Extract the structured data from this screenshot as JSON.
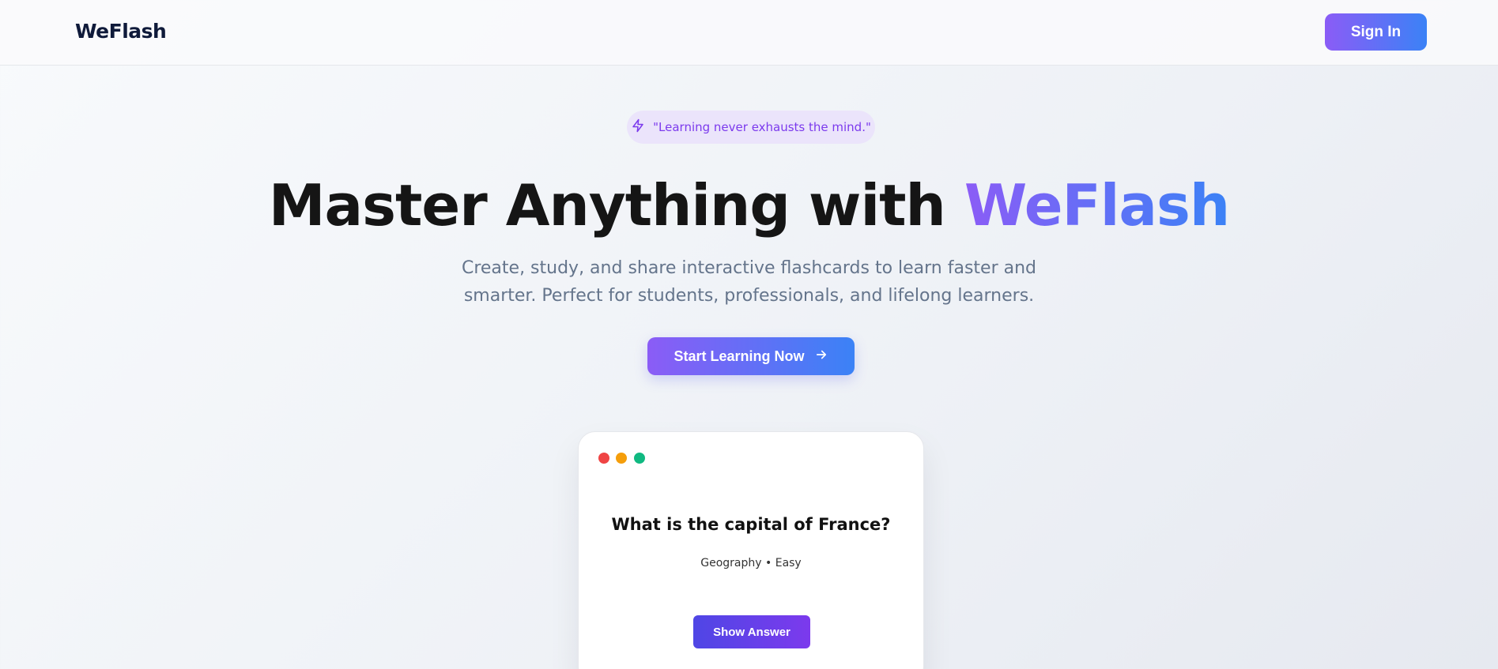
{
  "navbar": {
    "brand": "WeFlash",
    "signin_label": "Sign In"
  },
  "hero": {
    "quote": "\"Learning never exhausts the mind.\"",
    "quote_icon": "lightning-bolt-icon",
    "headline_main": "Master Anything with ",
    "headline_accent": "WeFlash",
    "subtitle": "Create, study, and share interactive flashcards to learn faster and smarter. Perfect for students, professionals, and lifelong learners.",
    "cta_label": "Start Learning Now",
    "cta_icon": "arrow-right-icon"
  },
  "flashcard": {
    "question": "What is the capital of France?",
    "meta": "Geography • Easy",
    "button_label": "Show Answer",
    "window_dots": [
      "#ef4444",
      "#f59e0b",
      "#10b981"
    ]
  },
  "colors": {
    "accent_start": "#8b5cf6",
    "accent_end": "#3b82f6",
    "brand_text": "#0f1a3a"
  }
}
